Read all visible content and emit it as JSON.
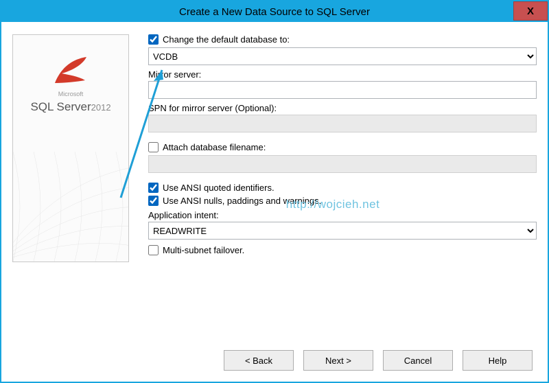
{
  "window": {
    "title": "Create a New Data Source to SQL Server",
    "close": "X"
  },
  "sidebar": {
    "vendor": "Microsoft",
    "product": "SQL Server",
    "year": "2012"
  },
  "form": {
    "change_db_label": "Change the default database to:",
    "change_db_checked": true,
    "db_value": "VCDB",
    "mirror_label": "Mirror server:",
    "mirror_value": "",
    "spn_label": "SPN for mirror server (Optional):",
    "spn_value": "",
    "attach_label": "Attach database filename:",
    "attach_checked": false,
    "attach_value": "",
    "ansi_quoted_label": "Use ANSI quoted identifiers.",
    "ansi_quoted_checked": true,
    "ansi_nulls_label": "Use ANSI nulls, paddings and warnings.",
    "ansi_nulls_checked": true,
    "app_intent_label": "Application intent:",
    "app_intent_value": "READWRITE",
    "multi_subnet_label": "Multi-subnet failover.",
    "multi_subnet_checked": false
  },
  "watermark": "http://wojcieh.net",
  "buttons": {
    "back": "< Back",
    "next": "Next >",
    "cancel": "Cancel",
    "help": "Help"
  }
}
